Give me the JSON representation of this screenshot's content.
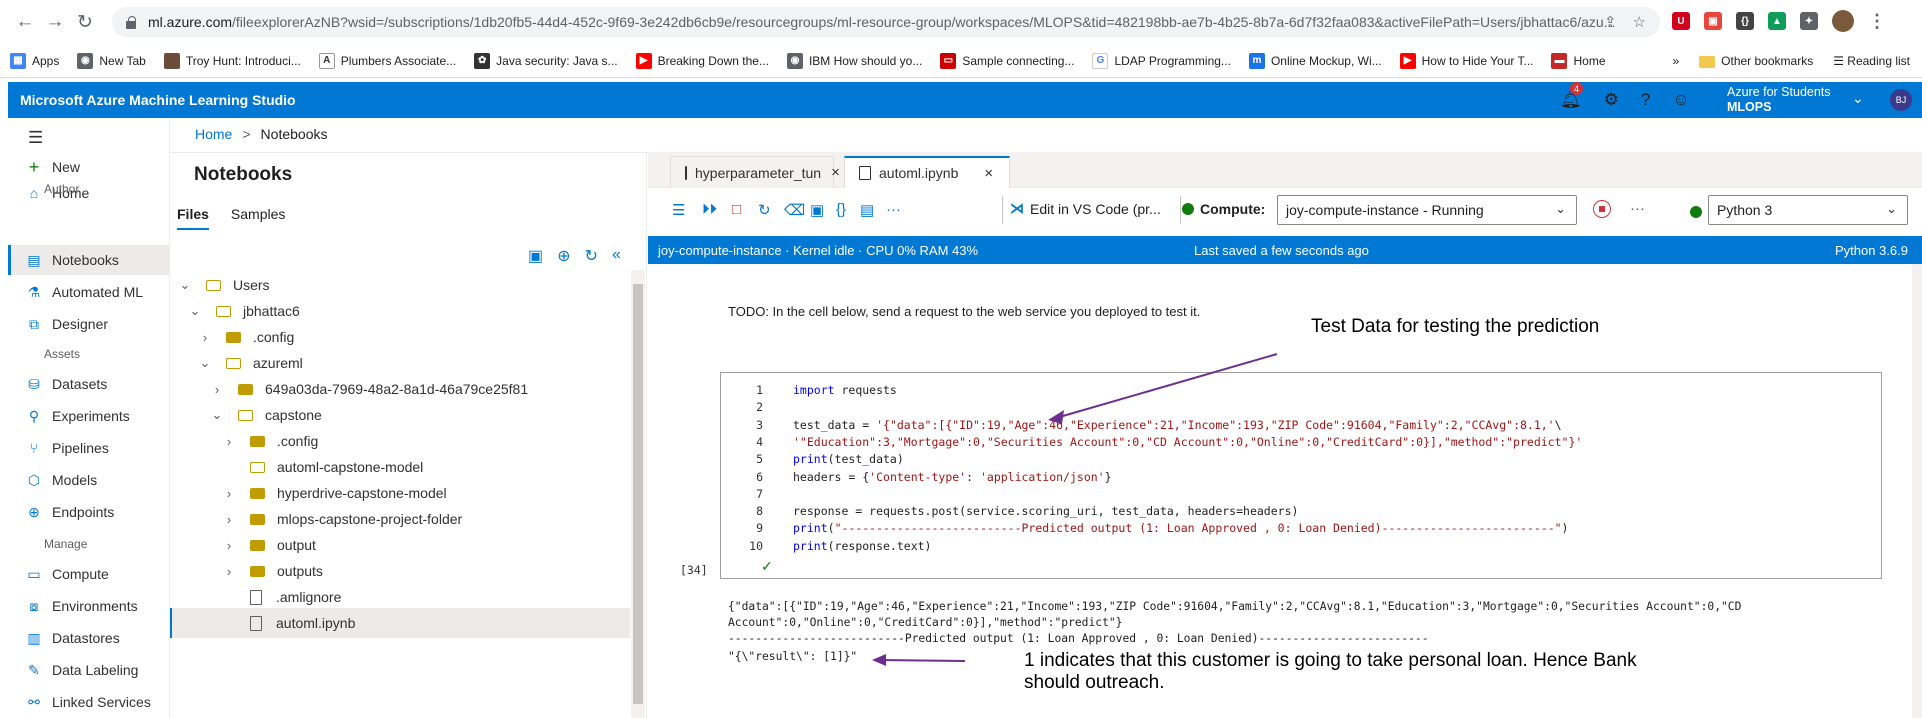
{
  "browser": {
    "url_host": "ml.azure.com",
    "url_rest": "/fileexplorerAzNB?wsid=/subscriptions/1db20fb5-44d4-452c-9f69-3e242db6cb9e/resourcegroups/ml-resource-group/workspaces/MLOPS&tid=482198bb-ae7b-4b25-8b7a-6d7f32faa083&activeFilePath=Users/jbhattac6/azu...",
    "bookmarks": [
      "Apps",
      "New Tab",
      "Troy Hunt: Introduci...",
      "Plumbers Associate...",
      "Java security: Java s...",
      "Breaking Down the...",
      "IBM How should yo...",
      "Sample connecting...",
      "LDAP Programming...",
      "Online Mockup, Wi...",
      "How to Hide Your T...",
      "Home"
    ],
    "bookmarks_overflow": "»",
    "other_bookmarks": "Other bookmarks",
    "reading_list": "Reading list"
  },
  "app": {
    "title": "Microsoft Azure Machine Learning Studio",
    "notification_count": "4",
    "account_name": "Azure for Students",
    "account_workspace": "MLOPS",
    "avatar_initials": "BJ"
  },
  "nav": {
    "items": [
      {
        "label": "New",
        "icon": "plus-icon"
      },
      {
        "label": "Home",
        "icon": "home-icon"
      },
      {
        "label": "Notebooks",
        "icon": "notebook-icon"
      },
      {
        "label": "Automated ML",
        "icon": "automl-icon"
      },
      {
        "label": "Designer",
        "icon": "designer-icon"
      },
      {
        "label": "Datasets",
        "icon": "datasets-icon"
      },
      {
        "label": "Experiments",
        "icon": "experiments-icon"
      },
      {
        "label": "Pipelines",
        "icon": "pipelines-icon"
      },
      {
        "label": "Models",
        "icon": "models-icon"
      },
      {
        "label": "Endpoints",
        "icon": "endpoints-icon"
      },
      {
        "label": "Compute",
        "icon": "compute-icon"
      },
      {
        "label": "Environments",
        "icon": "environments-icon"
      },
      {
        "label": "Datastores",
        "icon": "datastores-icon"
      },
      {
        "label": "Data Labeling",
        "icon": "labeling-icon"
      },
      {
        "label": "Linked Services",
        "icon": "linked-services-icon"
      }
    ],
    "section_author": "Author",
    "section_assets": "Assets",
    "section_manage": "Manage"
  },
  "breadcrumb": {
    "home": "Home",
    "separator": ">",
    "current": "Notebooks"
  },
  "files": {
    "title": "Notebooks",
    "tab_files": "Files",
    "tab_samples": "Samples",
    "tree": [
      {
        "label": "Users",
        "type": "folder-open",
        "chev": "⌄"
      },
      {
        "label": "jbhattac6",
        "type": "folder-open",
        "chev": "⌄"
      },
      {
        "label": ".config",
        "type": "folder",
        "chev": "›"
      },
      {
        "label": "azureml",
        "type": "folder-open",
        "chev": "⌄"
      },
      {
        "label": "649a03da-7969-48a2-8a1d-46a79ce25f81",
        "type": "folder",
        "chev": "›"
      },
      {
        "label": "capstone",
        "type": "folder-open",
        "chev": "⌄"
      },
      {
        "label": ".config",
        "type": "folder",
        "chev": "›"
      },
      {
        "label": "automl-capstone-model",
        "type": "folder-open",
        "chev": ""
      },
      {
        "label": "hyperdrive-capstone-model",
        "type": "folder",
        "chev": "›"
      },
      {
        "label": "mlops-capstone-project-folder",
        "type": "folder",
        "chev": "›"
      },
      {
        "label": "output",
        "type": "folder",
        "chev": "›"
      },
      {
        "label": "outputs",
        "type": "folder",
        "chev": "›"
      },
      {
        "label": ".amlignore",
        "type": "file",
        "chev": ""
      },
      {
        "label": "automl.ipynb",
        "type": "notebook",
        "chev": ""
      }
    ]
  },
  "editor": {
    "tabs": [
      {
        "label": "hyperparameter_tun",
        "close": "×"
      },
      {
        "label": "automl.ipynb",
        "close": "×"
      }
    ],
    "edit_vscode": "Edit in VS Code (pr...",
    "compute_label": "Compute:",
    "compute_value": "joy-compute-instance   -   Running",
    "kernel_value": "Python 3",
    "more": "···"
  },
  "status": {
    "left": "joy-compute-instance · Kernel idle · CPU  0%  RAM 43%",
    "center": "Last saved a few seconds ago",
    "right": "Python 3.6.9"
  },
  "notebook": {
    "markdown": "TODO: In the cell below, send a request to the web service you deployed to test it.",
    "exec_count": "[34]",
    "code": [
      {
        "n": "1",
        "segs": [
          {
            "t": "import",
            "c": "kw"
          },
          {
            "t": " requests",
            "c": ""
          }
        ]
      },
      {
        "n": "2",
        "segs": []
      },
      {
        "n": "3",
        "segs": [
          {
            "t": "test_data = ",
            "c": ""
          },
          {
            "t": "'{\"data\":[{\"ID\":19,\"Age\":46,\"Experience\":21,\"Income\":193,\"ZIP Code\":91604,\"Family\":2,\"CCAvg\":8.1,'",
            "c": "str"
          },
          {
            "t": "\\",
            "c": ""
          }
        ]
      },
      {
        "n": "4",
        "segs": [
          {
            "t": "'\"Education\":3,\"Mortgage\":0,\"Securities Account\":0,\"CD Account\":0,\"Online\":0,\"CreditCard\":0}],\"method\":\"predict\"}'",
            "c": "str"
          }
        ]
      },
      {
        "n": "5",
        "segs": [
          {
            "t": "print",
            "c": "kw"
          },
          {
            "t": "(test_data)",
            "c": ""
          }
        ]
      },
      {
        "n": "6",
        "segs": [
          {
            "t": "headers = {",
            "c": ""
          },
          {
            "t": "'Content-type'",
            "c": "str"
          },
          {
            "t": ": ",
            "c": ""
          },
          {
            "t": "'application/json'",
            "c": "str"
          },
          {
            "t": "}",
            "c": ""
          }
        ]
      },
      {
        "n": "7",
        "segs": []
      },
      {
        "n": "8",
        "segs": [
          {
            "t": "response = requests.post(service.scoring_uri, test_data, headers=headers)",
            "c": ""
          }
        ]
      },
      {
        "n": "9",
        "segs": [
          {
            "t": "print",
            "c": "kw"
          },
          {
            "t": "(",
            "c": ""
          },
          {
            "t": "\"--------------------------Predicted output (1: Loan Approved , 0: Loan Denied)-------------------------\"",
            "c": "str"
          },
          {
            "t": ")",
            "c": ""
          }
        ]
      },
      {
        "n": "10",
        "segs": [
          {
            "t": "print",
            "c": "kw"
          },
          {
            "t": "(response.text)",
            "c": ""
          }
        ]
      }
    ],
    "output": [
      "{\"data\":[{\"ID\":19,\"Age\":46,\"Experience\":21,\"Income\":193,\"ZIP Code\":91604,\"Family\":2,\"CCAvg\":8.1,\"Education\":3,\"Mortgage\":0,\"Securities Account\":0,\"CD",
      "Account\":0,\"Online\":0,\"CreditCard\":0}],\"method\":\"predict\"}",
      "--------------------------Predicted output (1: Loan Approved , 0: Loan Denied)-------------------------",
      "\"{\\\"result\\\": [1]}\""
    ]
  },
  "annotations": {
    "test_data": "Test Data for testing the prediction",
    "result_line1": "1 indicates that this customer is going to take personal loan. Hence Bank",
    "result_line2": "should outreach.",
    "arrow_color": "#6b2f8f"
  },
  "colors": {
    "accent": "#0078d4",
    "running": "#107c10",
    "stop": "#d13438"
  }
}
